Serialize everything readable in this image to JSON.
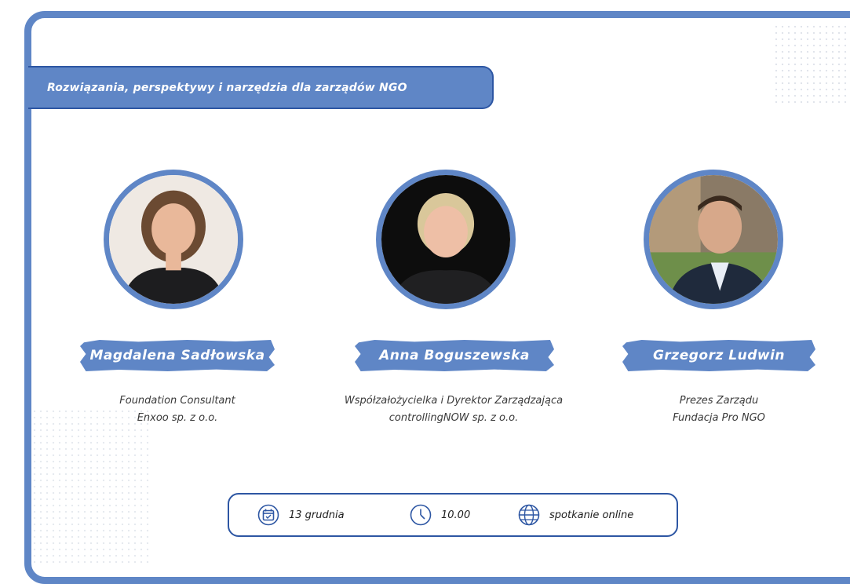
{
  "banner": {
    "title": "Rozwiązania, perspektywy i narzędzia dla zarządów NGO"
  },
  "speakers": [
    {
      "name": "Magdalena Sadłowska",
      "role_line1": "Foundation Consultant",
      "role_line2": "Enxoo sp. z o.o.",
      "photo": "portrait-woman-dark-hair"
    },
    {
      "name": "Anna Boguszewska",
      "role_line1": "Współzałożycielka i Dyrektor Zarządzająca",
      "role_line2": "controllingNOW sp. z o.o.",
      "photo": "portrait-woman-blonde"
    },
    {
      "name": "Grzegorz Ludwin",
      "role_line1": "Prezes Zarządu",
      "role_line2": "Fundacja Pro NGO",
      "photo": "portrait-man-suit"
    }
  ],
  "event": {
    "date": "13 grudnia",
    "time": "10.00",
    "location": "spotkanie online",
    "date_icon": "calendar-icon",
    "time_icon": "clock-icon",
    "location_icon": "globe-icon"
  },
  "colors": {
    "accent": "#5f86c6",
    "accent_dark": "#2d56a3"
  }
}
